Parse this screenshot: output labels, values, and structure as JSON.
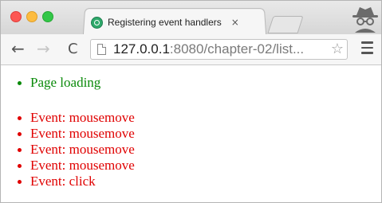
{
  "browser": {
    "tab": {
      "title": "Registering event handlers",
      "close_glyph": "×",
      "favicon": "page-favicon"
    },
    "toolbar": {
      "back_glyph": "←",
      "forward_glyph": "→",
      "reload_glyph": "C",
      "url_host": "127.0.0.1",
      "url_rest": ":8080/chapter-02/list...",
      "bookmark_glyph": "☆"
    },
    "colors": {
      "tab_active": "#f6f6f6",
      "close_red": "#fc5753",
      "minimize_yellow": "#fdbc40",
      "maximize_green": "#33c748"
    }
  },
  "page": {
    "status_items": [
      {
        "text": "Page loading",
        "color": "#0a8a0a"
      }
    ],
    "event_items": [
      {
        "text": "Event: mousemove",
        "color": "#e00000"
      },
      {
        "text": "Event: mousemove",
        "color": "#e00000"
      },
      {
        "text": "Event: mousemove",
        "color": "#e00000"
      },
      {
        "text": "Event: mousemove",
        "color": "#e00000"
      },
      {
        "text": "Event: click",
        "color": "#e00000"
      }
    ]
  }
}
